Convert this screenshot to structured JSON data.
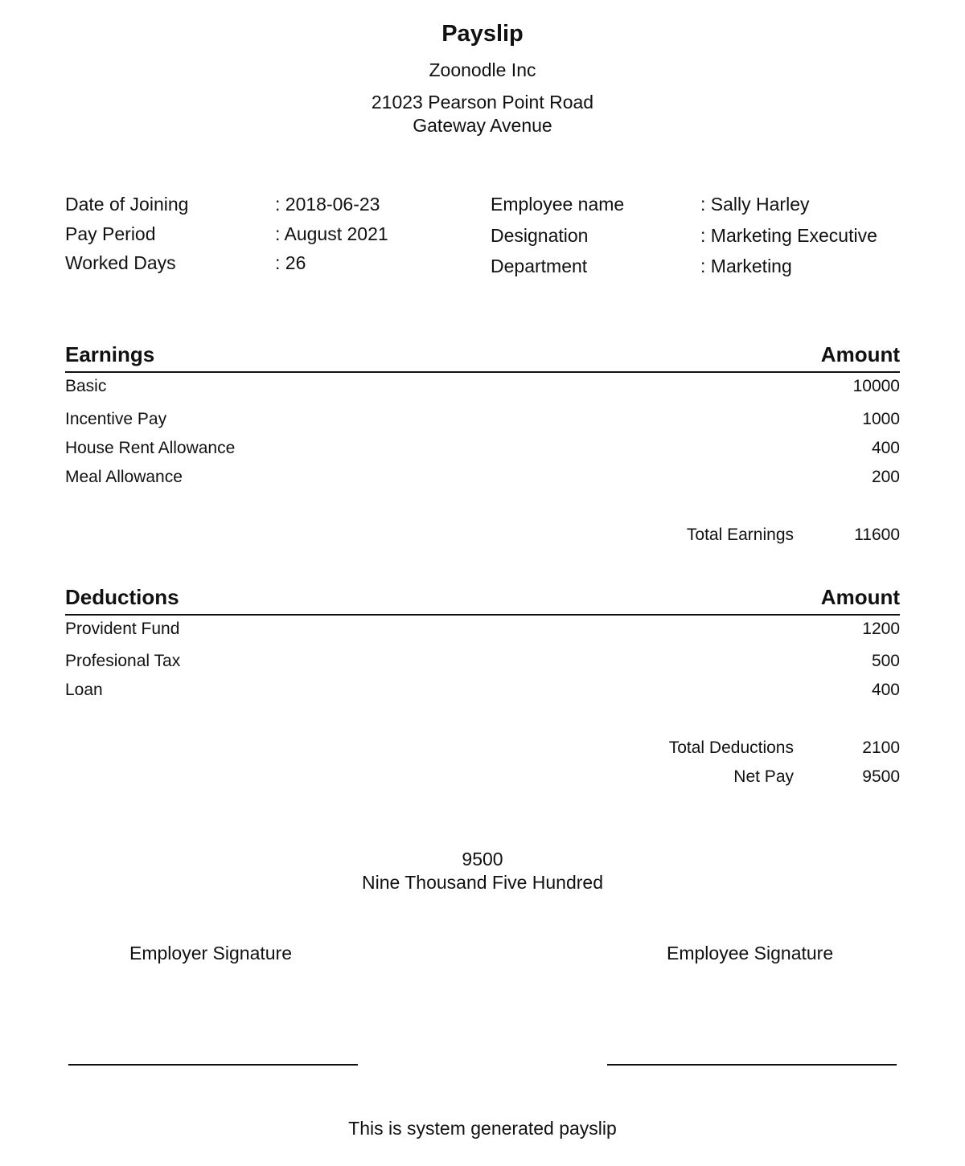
{
  "header": {
    "title": "Payslip",
    "company": "Zoonodle Inc",
    "address_line1": "21023 Pearson Point Road",
    "address_line2": "Gateway Avenue"
  },
  "employee_info": {
    "left": [
      {
        "label": "Date of Joining",
        "value": ": 2018-06-23"
      },
      {
        "label": "Pay Period",
        "value": ": August 2021"
      },
      {
        "label": "Worked Days",
        "value": ": 26"
      }
    ],
    "right": [
      {
        "label": "Employee name",
        "value": ": Sally Harley"
      },
      {
        "label": "Designation",
        "value": ": Marketing Executive"
      },
      {
        "label": "Department",
        "value": ": Marketing"
      }
    ]
  },
  "earnings": {
    "heading": "Earnings",
    "amount_heading": "Amount",
    "items": [
      {
        "label": "Basic",
        "amount": "10000"
      },
      {
        "label": "Incentive Pay",
        "amount": "1000"
      },
      {
        "label": "House Rent Allowance",
        "amount": "400"
      },
      {
        "label": "Meal Allowance",
        "amount": "200"
      }
    ],
    "total_label": "Total Earnings",
    "total_amount": "11600"
  },
  "deductions": {
    "heading": "Deductions",
    "amount_heading": "Amount",
    "items": [
      {
        "label": "Provident Fund",
        "amount": "1200"
      },
      {
        "label": "Profesional Tax",
        "amount": "500"
      },
      {
        "label": "Loan",
        "amount": "400"
      }
    ],
    "total_label": "Total Deductions",
    "total_amount": "2100",
    "net_pay_label": "Net Pay",
    "net_pay_amount": "9500"
  },
  "net_pay_summary": {
    "amount": "9500",
    "in_words": "Nine Thousand Five Hundred"
  },
  "signatures": {
    "employer": "Employer Signature",
    "employee": "Employee Signature"
  },
  "footer": {
    "note": "This is system generated payslip"
  }
}
